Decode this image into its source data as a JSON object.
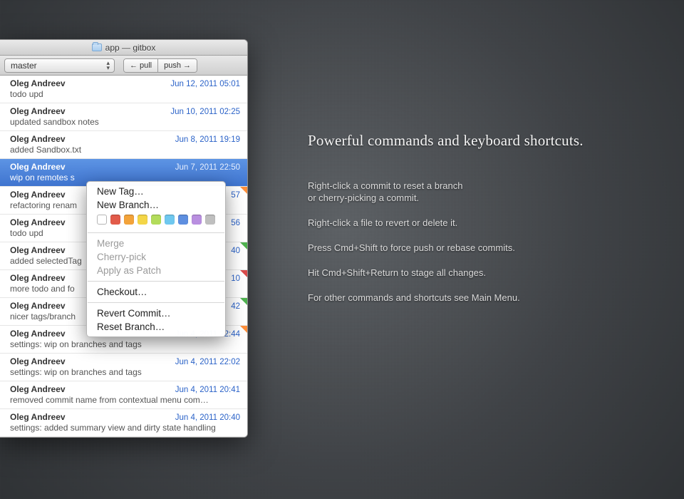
{
  "titlebar": {
    "title": "app — gitbox"
  },
  "toolbar": {
    "branch": "master",
    "pull_label": "pull",
    "push_label": "push"
  },
  "commits": [
    {
      "author": "Oleg Andreev",
      "date": "Jun 12, 2011 05:01",
      "msg": "todo upd"
    },
    {
      "author": "Oleg Andreev",
      "date": "Jun 10, 2011 02:25",
      "msg": "updated sandbox notes"
    },
    {
      "author": "Oleg Andreev",
      "date": "Jun 8, 2011 19:19",
      "msg": "added Sandbox.txt"
    },
    {
      "author": "Oleg Andreev",
      "date": "Jun 7, 2011 22:50",
      "msg": "wip on remotes s",
      "selected": true
    },
    {
      "author": "Oleg Andreev",
      "date": "57",
      "msg": "refactoring renam",
      "corner": "#ff8f3a"
    },
    {
      "author": "Oleg Andreev",
      "date": "56",
      "msg": "todo upd"
    },
    {
      "author": "Oleg Andreev",
      "date": "40",
      "msg": "added selectedTag",
      "corner": "#4fb24f"
    },
    {
      "author": "Oleg Andreev",
      "date": "10",
      "msg": "more todo and fo",
      "corner": "#d94b4b"
    },
    {
      "author": "Oleg Andreev",
      "date": "42",
      "msg": "nicer tags/branch",
      "corner": "#4fb24f"
    },
    {
      "author": "Oleg Andreev",
      "date": "Jun 4, 2011 22:44",
      "msg": "settings: wip on branches and tags",
      "corner": "#ff8f3a"
    },
    {
      "author": "Oleg Andreev",
      "date": "Jun 4, 2011 22:02",
      "msg": "settings: wip on branches and tags"
    },
    {
      "author": "Oleg Andreev",
      "date": "Jun 4, 2011 20:41",
      "msg": "removed commit name from contextual menu com…"
    },
    {
      "author": "Oleg Andreev",
      "date": "Jun 4, 2011 20:40",
      "msg": "settings: added summary view and dirty state handling"
    }
  ],
  "context_menu": {
    "new_tag": "New Tag…",
    "new_branch": "New Branch…",
    "merge": "Merge",
    "cherry_pick": "Cherry-pick",
    "apply_patch": "Apply as Patch",
    "checkout": "Checkout…",
    "revert_commit": "Revert Commit…",
    "reset_branch": "Reset Branch…",
    "swatches": [
      "empty",
      "#e25b4a",
      "#f3a33a",
      "#f4d647",
      "#b3dc5b",
      "#6fc8ef",
      "#5e8fe0",
      "#b98fe0",
      "#bfbfbf"
    ]
  },
  "promo": {
    "heading": "Powerful commands and keyboard shortcuts.",
    "p1a": "Right-click a commit to reset a branch",
    "p1b": "or cherry-picking a commit.",
    "p2": "Right-click a file to revert or delete it.",
    "p3": "Press Cmd+Shift to force push or rebase commits.",
    "p4": "Hit Cmd+Shift+Return to stage all changes.",
    "p5": "For other commands and shortcuts see Main Menu."
  }
}
